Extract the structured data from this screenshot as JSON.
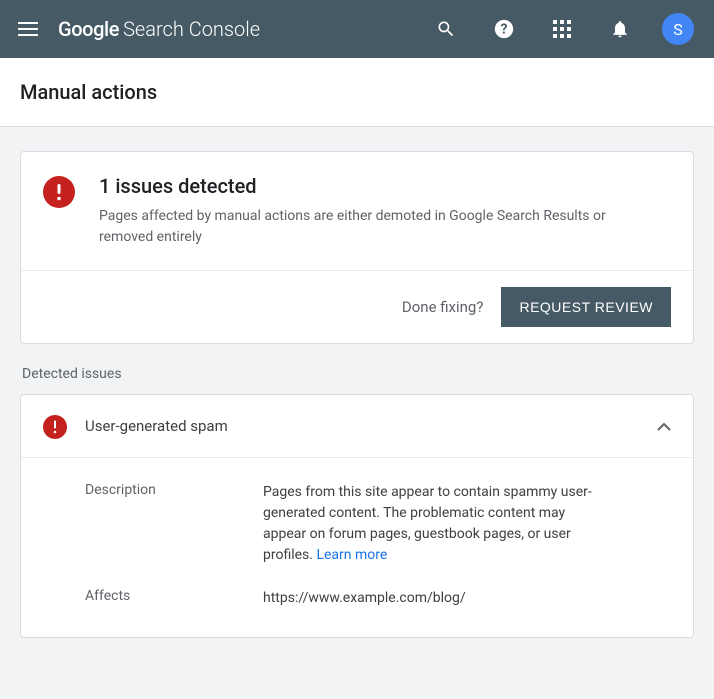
{
  "header": {
    "logo_primary": "Google",
    "logo_secondary": "Search Console",
    "avatar_initial": "S"
  },
  "page_title": "Manual actions",
  "summary": {
    "title": "1 issues detected",
    "description": "Pages affected by manual actions are either demoted in Google Search Results or removed entirely",
    "done_prompt": "Done fixing?",
    "review_button": "REQUEST REVIEW"
  },
  "detected_label": "Detected issues",
  "issue": {
    "title": "User-generated spam",
    "description_label": "Description",
    "description_text": "Pages from this site appear to contain spammy user-generated content. The problematic content may appear on forum pages, guestbook pages, or user profiles. ",
    "learn_more": "Learn more",
    "affects_label": "Affects",
    "affects_value": "https://www.example.com/blog/"
  }
}
